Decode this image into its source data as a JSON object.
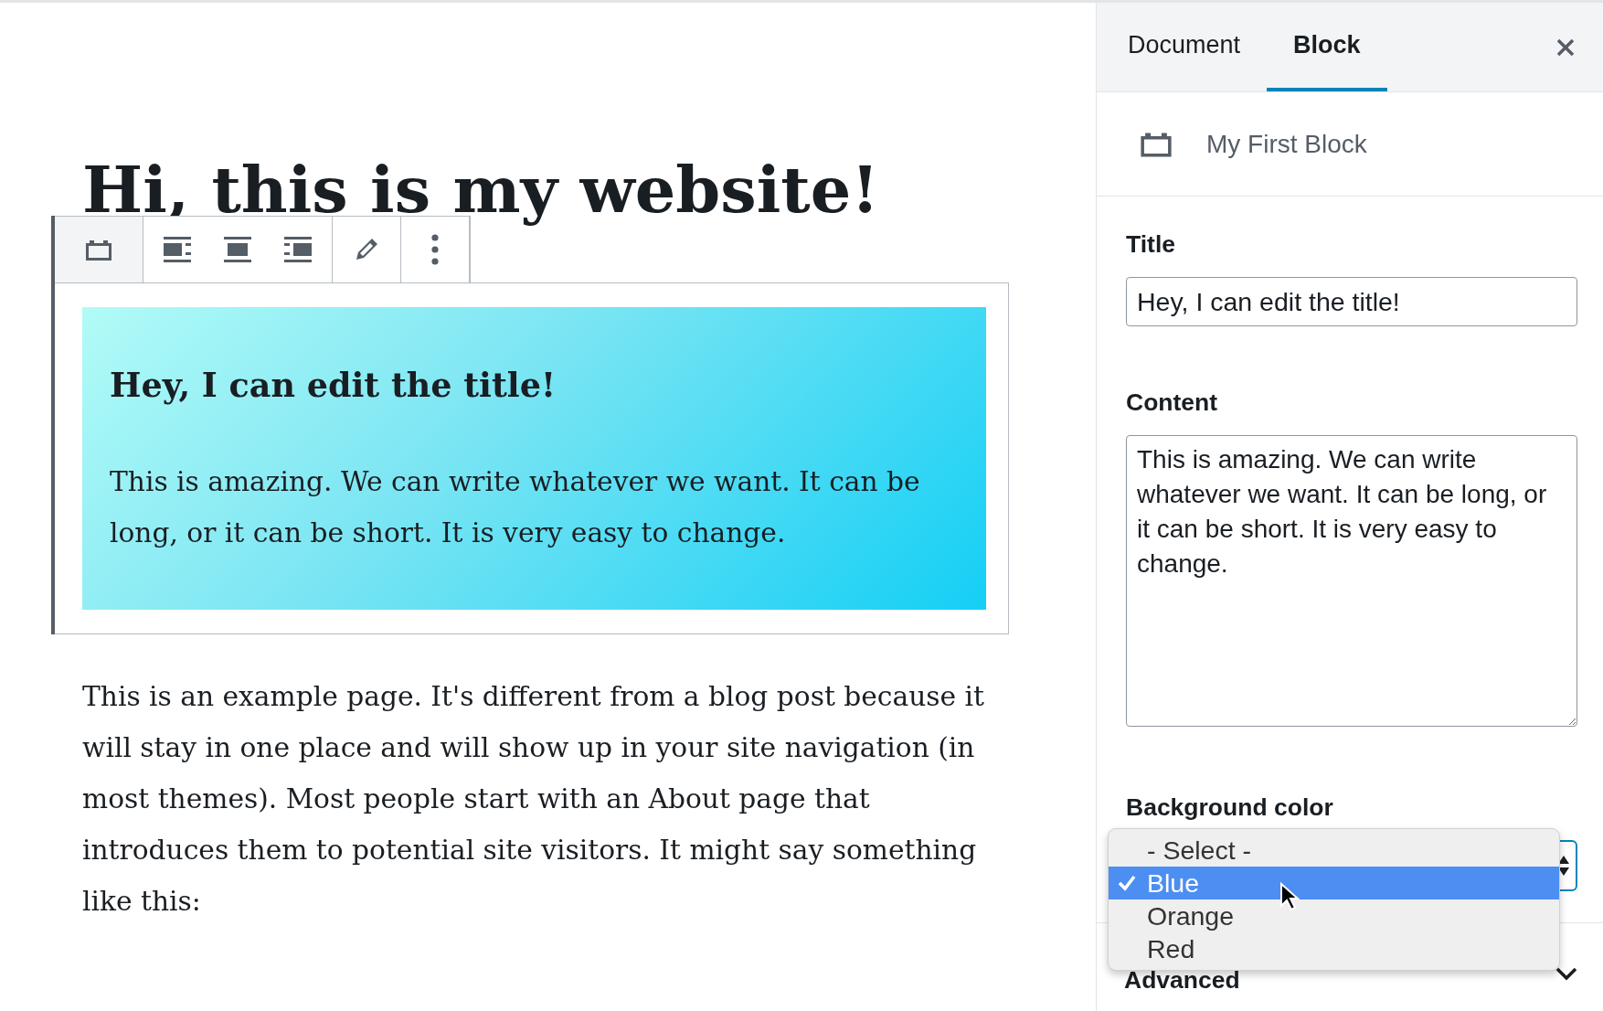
{
  "editor": {
    "heading": "Hi, this is my website!",
    "block": {
      "selected": true,
      "title": "Hey, I can edit the title!",
      "content": "This is amazing. We can write whatever we want. It can be long, or it can be short. It is very easy to change."
    },
    "paragraph": "This is an example page. It's different from a blog post because it will stay in one place and will show up in your site navigation (in most themes). Most people start with an About page that introduces them to potential site visitors. It might say something like this:"
  },
  "sidebar": {
    "tabs": [
      {
        "label": "Document",
        "selected": false
      },
      {
        "label": "Block",
        "selected": true
      }
    ],
    "block_name": "My First Block",
    "fields": [
      {
        "kind": "text",
        "label": "Title",
        "value": "Hey, I can edit the title!"
      },
      {
        "kind": "textarea",
        "label": "Content",
        "value": "This is amazing. We can write whatever we want. It can be long, or it can be short. It is very easy to change."
      },
      {
        "kind": "select",
        "label": "Background color"
      }
    ],
    "dropdown": {
      "options": [
        {
          "label": "- Select -",
          "selected": false
        },
        {
          "label": "Blue",
          "selected": true
        },
        {
          "label": "Orange",
          "selected": false
        },
        {
          "label": "Red",
          "selected": false
        }
      ]
    },
    "panels": [
      {
        "label": "Advanced",
        "expanded": false
      }
    ]
  }
}
